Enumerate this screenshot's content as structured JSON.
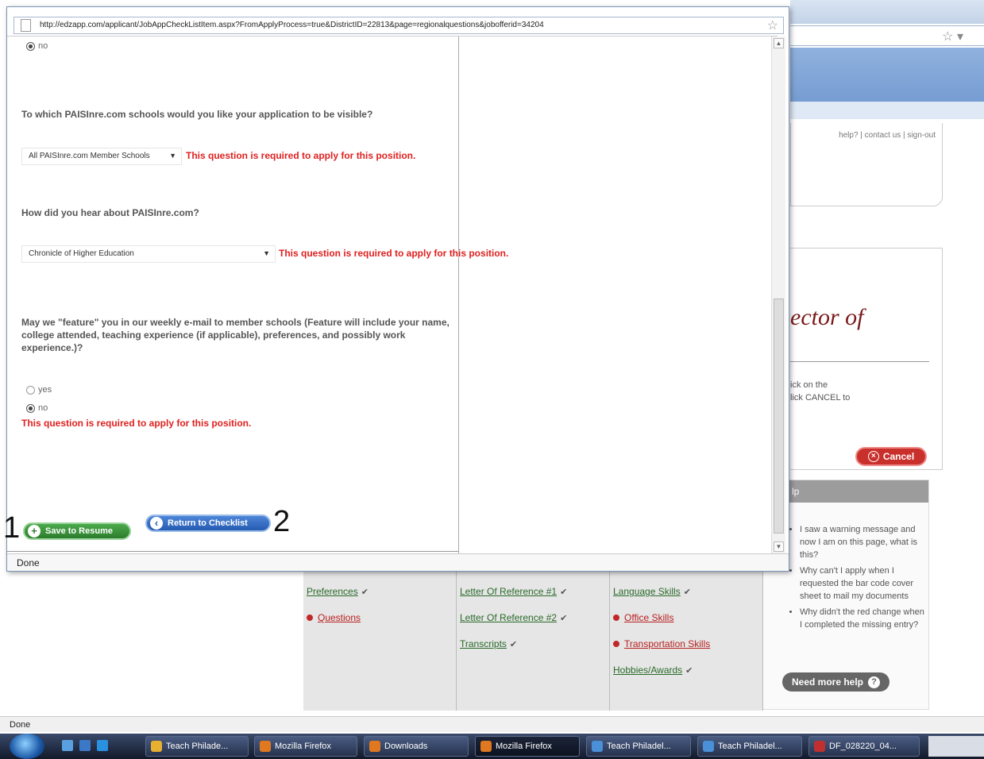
{
  "popup": {
    "url": "http://edzapp.com/applicant/JobAppCheckListItem.aspx?FromApplyProcess=true&DistrictID=22813&page=regionalquestions&jobofferid=34204",
    "top_radio_label": "no",
    "q1_text": "To which PAISInre.com schools would you like your application to be visible?",
    "q1_select": "All PAISInre.com Member Schools",
    "q2_text": "How did you hear about PAISInre.com?",
    "q2_select": "Chronicle of Higher Education",
    "required_msg": "This question is required to apply for this position.",
    "q3_text": "May we \"feature\" you in our weekly e-mail to member schools (Feature will include your name, college attended, teaching experience (if applicable), preferences, and possibly work experience.)?",
    "q3_yes": "yes",
    "q3_no": "no",
    "save_label": "Save to Resume",
    "return_label": "Return to Checklist",
    "status": "Done"
  },
  "annotations": {
    "label1": "1",
    "label2": "2"
  },
  "background": {
    "header_links": "help? | contact us | sign-out",
    "title_fragment": "ector of",
    "desc_line1": "ick on the",
    "desc_line2": "lick CANCEL to",
    "cancel_label": "Cancel",
    "help_title": "lp",
    "help_items": [
      "I saw a warning message and now I am on this page, what is this?",
      "Why can't I apply when I requested the bar code cover sheet to mail my documents",
      "Why didn't the red change when I completed the missing entry?"
    ],
    "need_help_label": "Need more help",
    "checklist": {
      "col1": [
        {
          "label": "Preferences",
          "status": "ok"
        },
        {
          "label": "Questions",
          "status": "missing"
        }
      ],
      "col2": [
        {
          "label": "Letter Of Reference #1",
          "status": "ok"
        },
        {
          "label": "Letter Of Reference #2",
          "status": "ok"
        },
        {
          "label": "Transcripts",
          "status": "ok"
        }
      ],
      "col3": [
        {
          "label": "Language Skills",
          "status": "ok"
        },
        {
          "label": "Office Skills",
          "status": "missing"
        },
        {
          "label": "Transportation Skills",
          "status": "missing"
        },
        {
          "label": "Hobbies/Awards",
          "status": "ok"
        }
      ]
    },
    "status": "Done"
  },
  "taskbar": {
    "items": [
      {
        "label": "Teach Philade...",
        "color": "#e8b030"
      },
      {
        "label": "Mozilla Firefox",
        "color": "#e07820"
      },
      {
        "label": "Downloads",
        "color": "#e07820"
      },
      {
        "label": "Mozilla Firefox",
        "color": "#e07820"
      },
      {
        "label": "Teach Philadel...",
        "color": "#4a90d9"
      },
      {
        "label": "Teach Philadel...",
        "color": "#4a90d9"
      },
      {
        "label": "DF_028220_04...",
        "color": "#c03030"
      }
    ]
  }
}
